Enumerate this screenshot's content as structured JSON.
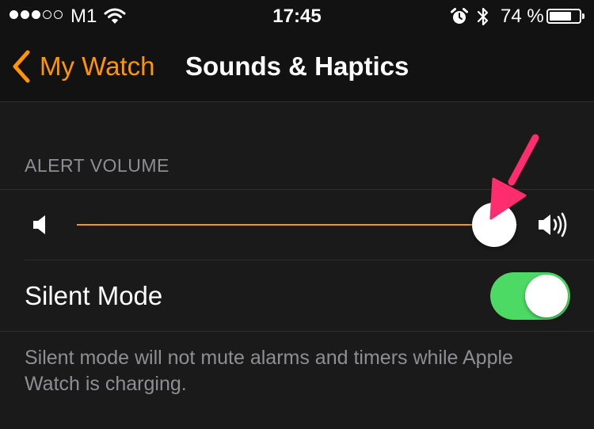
{
  "status_bar": {
    "signal_bars_filled": 3,
    "signal_bars_total": 5,
    "carrier": "M1",
    "time": "17:45",
    "battery_percent": "74 %",
    "battery_level": 0.74,
    "icons": [
      "wifi-icon",
      "alarm-icon",
      "bluetooth-icon",
      "battery-icon"
    ]
  },
  "nav": {
    "back_label": "My Watch",
    "title": "Sounds & Haptics",
    "accent_color": "#ff9500"
  },
  "alert_volume": {
    "section_header": "ALERT VOLUME",
    "level": 0.948,
    "min_icon": "speaker-low-icon",
    "max_icon": "speaker-high-icon"
  },
  "silent_mode": {
    "label": "Silent Mode",
    "enabled": true,
    "toggle_color": "#4cd964"
  },
  "footer_note": "Silent mode will not mute alarms and timers while Apple Watch is charging.",
  "annotation": {
    "type": "arrow",
    "color": "#ff2d6f"
  }
}
